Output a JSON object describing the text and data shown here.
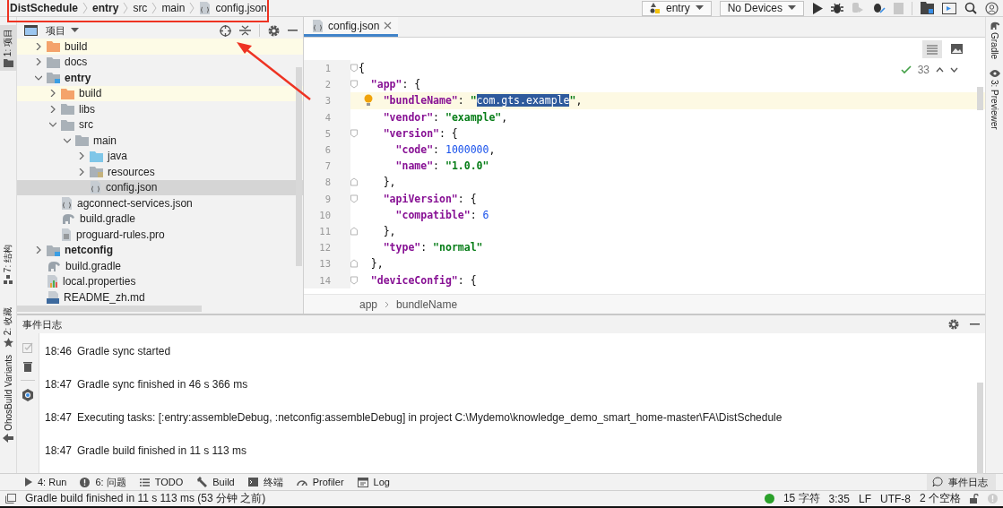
{
  "breadcrumb": [
    {
      "label": "DistSchedule",
      "bold": true
    },
    {
      "label": "entry",
      "bold": true
    },
    {
      "label": "src",
      "bold": false
    },
    {
      "label": "main",
      "bold": false
    },
    {
      "label": "config.json",
      "bold": false,
      "kind": "json"
    }
  ],
  "toolbar": {
    "run_config": "entry",
    "device": "No Devices"
  },
  "left_strip": [
    {
      "label": "1: 项目",
      "selected": true,
      "kind": "folder"
    },
    {
      "label": "7: 结构",
      "selected": false,
      "kind": "structure"
    },
    {
      "label": "2: 收藏",
      "selected": false,
      "kind": "star"
    },
    {
      "label": "OhosBuild Variants",
      "selected": false,
      "kind": "variants"
    }
  ],
  "right_strip": [
    {
      "label": "Gradle",
      "kind": "gradle"
    },
    {
      "label": "3: Previewer",
      "kind": "eye"
    }
  ],
  "project_panel": {
    "title": "项目",
    "tree": [
      {
        "label": "build",
        "kind": "excluded-folder",
        "expanded": false,
        "selected": false
      },
      {
        "label": "docs",
        "kind": "folder",
        "expanded": false,
        "selected": false
      },
      {
        "label": "entry",
        "kind": "module",
        "expanded": true,
        "selected": false,
        "children": [
          {
            "label": "build",
            "kind": "excluded-folder",
            "expanded": false,
            "selected": false
          },
          {
            "label": "libs",
            "kind": "folder",
            "expanded": false,
            "selected": false
          },
          {
            "label": "src",
            "kind": "folder",
            "expanded": true,
            "selected": false,
            "children": [
              {
                "label": "main",
                "kind": "folder",
                "expanded": true,
                "selected": false,
                "children": [
                  {
                    "label": "java",
                    "kind": "source-folder",
                    "expanded": false,
                    "selected": false
                  },
                  {
                    "label": "resources",
                    "kind": "resource-folder",
                    "expanded": false,
                    "selected": false
                  },
                  {
                    "label": "config.json",
                    "kind": "json",
                    "selected": true
                  }
                ]
              }
            ]
          },
          {
            "label": "agconnect-services.json",
            "kind": "json",
            "selected": false
          },
          {
            "label": "build.gradle",
            "kind": "gradle",
            "selected": false
          },
          {
            "label": "proguard-rules.pro",
            "kind": "text",
            "selected": false
          }
        ]
      },
      {
        "label": "netconfig",
        "kind": "module",
        "expanded": false,
        "selected": false
      },
      {
        "label": "build.gradle",
        "kind": "gradle",
        "selected": false
      },
      {
        "label": "local.properties",
        "kind": "properties",
        "selected": false
      },
      {
        "label": "README_zh.md",
        "kind": "markdown",
        "selected": false
      }
    ]
  },
  "editor": {
    "tabs": [
      {
        "label": "config.json",
        "selected": true
      }
    ],
    "inspections": "33",
    "breadcrumb": [
      "app",
      "bundleName"
    ],
    "lines": [
      {
        "n": "1",
        "fold_start": true,
        "tokens": [
          {
            "kind": "punc",
            "text": "{"
          }
        ]
      },
      {
        "n": "2",
        "fold_start": true,
        "tokens": [
          {
            "kind": "key",
            "text": "  \"app\""
          },
          {
            "kind": "punc",
            "text": ": {"
          }
        ]
      },
      {
        "n": "3",
        "current": true,
        "bulb": true,
        "tokens": [
          {
            "kind": "key",
            "text": "    \"bundleName\""
          },
          {
            "kind": "punc",
            "text": ": "
          },
          {
            "kind": "str",
            "text": "\""
          },
          {
            "kind": "selection",
            "text": "com.gts.example"
          },
          {
            "kind": "str",
            "text": "\""
          },
          {
            "kind": "punc",
            "text": ","
          }
        ]
      },
      {
        "n": "4",
        "tokens": [
          {
            "kind": "key",
            "text": "    \"vendor\""
          },
          {
            "kind": "punc",
            "text": ": "
          },
          {
            "kind": "str",
            "text": "\"example\""
          },
          {
            "kind": "punc",
            "text": ","
          }
        ]
      },
      {
        "n": "5",
        "fold_start": true,
        "tokens": [
          {
            "kind": "key",
            "text": "    \"version\""
          },
          {
            "kind": "punc",
            "text": ": {"
          }
        ]
      },
      {
        "n": "6",
        "tokens": [
          {
            "kind": "key",
            "text": "      \"code\""
          },
          {
            "kind": "punc",
            "text": ": "
          },
          {
            "kind": "num",
            "text": "1000000"
          },
          {
            "kind": "punc",
            "text": ","
          }
        ]
      },
      {
        "n": "7",
        "tokens": [
          {
            "kind": "key",
            "text": "      \"name\""
          },
          {
            "kind": "punc",
            "text": ": "
          },
          {
            "kind": "str",
            "text": "\"1.0.0\""
          }
        ]
      },
      {
        "n": "8",
        "fold_end": true,
        "tokens": [
          {
            "kind": "punc",
            "text": "    },"
          }
        ]
      },
      {
        "n": "9",
        "fold_start": true,
        "tokens": [
          {
            "kind": "key",
            "text": "    \"apiVersion\""
          },
          {
            "kind": "punc",
            "text": ": {"
          }
        ]
      },
      {
        "n": "10",
        "tokens": [
          {
            "kind": "key",
            "text": "      \"compatible\""
          },
          {
            "kind": "punc",
            "text": ": "
          },
          {
            "kind": "num",
            "text": "6"
          }
        ]
      },
      {
        "n": "11",
        "fold_end": true,
        "tokens": [
          {
            "kind": "punc",
            "text": "    },"
          }
        ]
      },
      {
        "n": "12",
        "tokens": [
          {
            "kind": "key",
            "text": "    \"type\""
          },
          {
            "kind": "punc",
            "text": ": "
          },
          {
            "kind": "str",
            "text": "\"normal\""
          }
        ]
      },
      {
        "n": "13",
        "fold_end": true,
        "tokens": [
          {
            "kind": "punc",
            "text": "  },"
          }
        ]
      },
      {
        "n": "14",
        "fold_start": true,
        "tokens": [
          {
            "kind": "key",
            "text": "  \"deviceConfig\""
          },
          {
            "kind": "punc",
            "text": ": {"
          }
        ]
      }
    ]
  },
  "event_log": {
    "title": "事件日志",
    "entries": [
      {
        "time": "18:46",
        "message": "Gradle sync started"
      },
      {
        "time": "18:47",
        "message": "Gradle sync finished in 46 s 366 ms"
      },
      {
        "time": "18:47",
        "message": "Executing tasks: [:entry:assembleDebug, :netconfig:assembleDebug] in project C:\\Mydemo\\knowledge_demo_smart_home-master\\FA\\DistSchedule"
      },
      {
        "time": "18:47",
        "message": "Gradle build finished in 11 s 113 ms"
      }
    ]
  },
  "tool_windows": [
    {
      "label": "4: Run",
      "kind": "run"
    },
    {
      "label": "6: 问题",
      "kind": "problems"
    },
    {
      "label": "TODO",
      "kind": "todo"
    },
    {
      "label": "Build",
      "kind": "build"
    },
    {
      "label": "终端",
      "kind": "terminal"
    },
    {
      "label": "Profiler",
      "kind": "profiler"
    },
    {
      "label": "Log",
      "kind": "log"
    }
  ],
  "event_log_button": "事件日志",
  "status_bar": {
    "message": "Gradle build finished in 11 s 113 ms (53 分钟 之前)",
    "chars": "15 字符",
    "position": "3:35",
    "line_ending": "LF",
    "encoding": "UTF-8",
    "indent": "2 个空格"
  }
}
